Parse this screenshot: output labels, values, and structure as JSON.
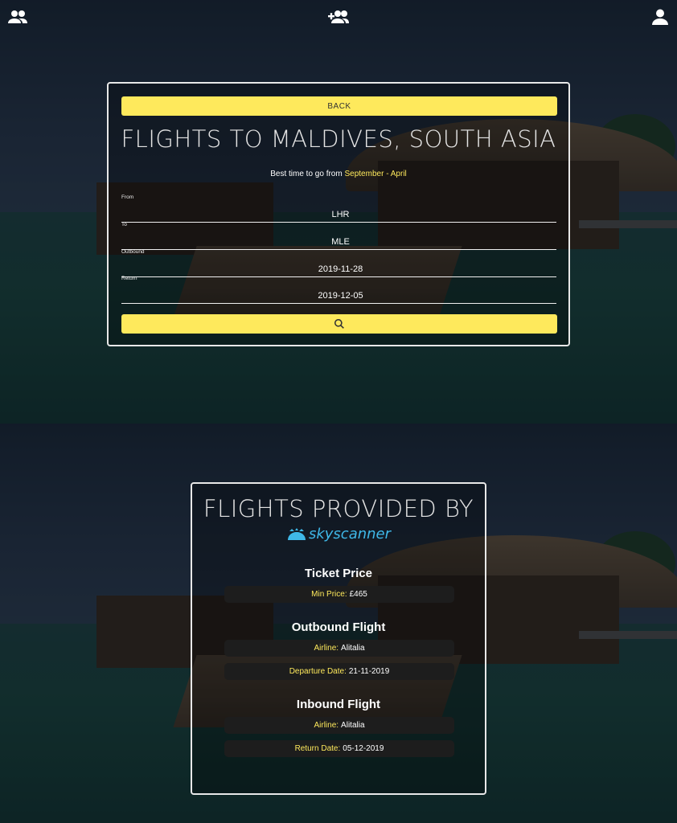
{
  "nav": {
    "left_icon": "group-icon",
    "center_icon": "add-group-icon",
    "right_icon": "user-icon"
  },
  "search": {
    "back_label": "BACK",
    "title": "FLIGHTS TO MALDIVES, SOUTH ASIA",
    "best_time_prefix": "Best time to go from",
    "best_time_start": "September",
    "best_time_sep": "-",
    "best_time_end": "April",
    "fields": [
      {
        "label": "From",
        "value": "LHR"
      },
      {
        "label": "To",
        "value": "MLE"
      },
      {
        "label": "Outbound",
        "value": "2019-11-28"
      },
      {
        "label": "Return",
        "value": "2019-12-05"
      }
    ],
    "search_icon": "search-icon"
  },
  "results": {
    "title": "FLIGHTS PROVIDED BY",
    "provider": "skyscanner",
    "ticket_heading": "Ticket Price",
    "min_price_label": "Min Price:",
    "min_price_value": "£465",
    "outbound_heading": "Outbound Flight",
    "outbound_airline_label": "Airline:",
    "outbound_airline_value": "Alitalia",
    "departure_label": "Departure Date:",
    "departure_value": "21-11-2019",
    "inbound_heading": "Inbound Flight",
    "inbound_airline_label": "Airline:",
    "inbound_airline_value": "Alitalia",
    "return_label": "Return Date:",
    "return_value": "05-12-2019"
  },
  "colors": {
    "accent": "#fee95c",
    "pill_bg": "#1d1d1d",
    "provider_blue": "#3fb8e8"
  }
}
